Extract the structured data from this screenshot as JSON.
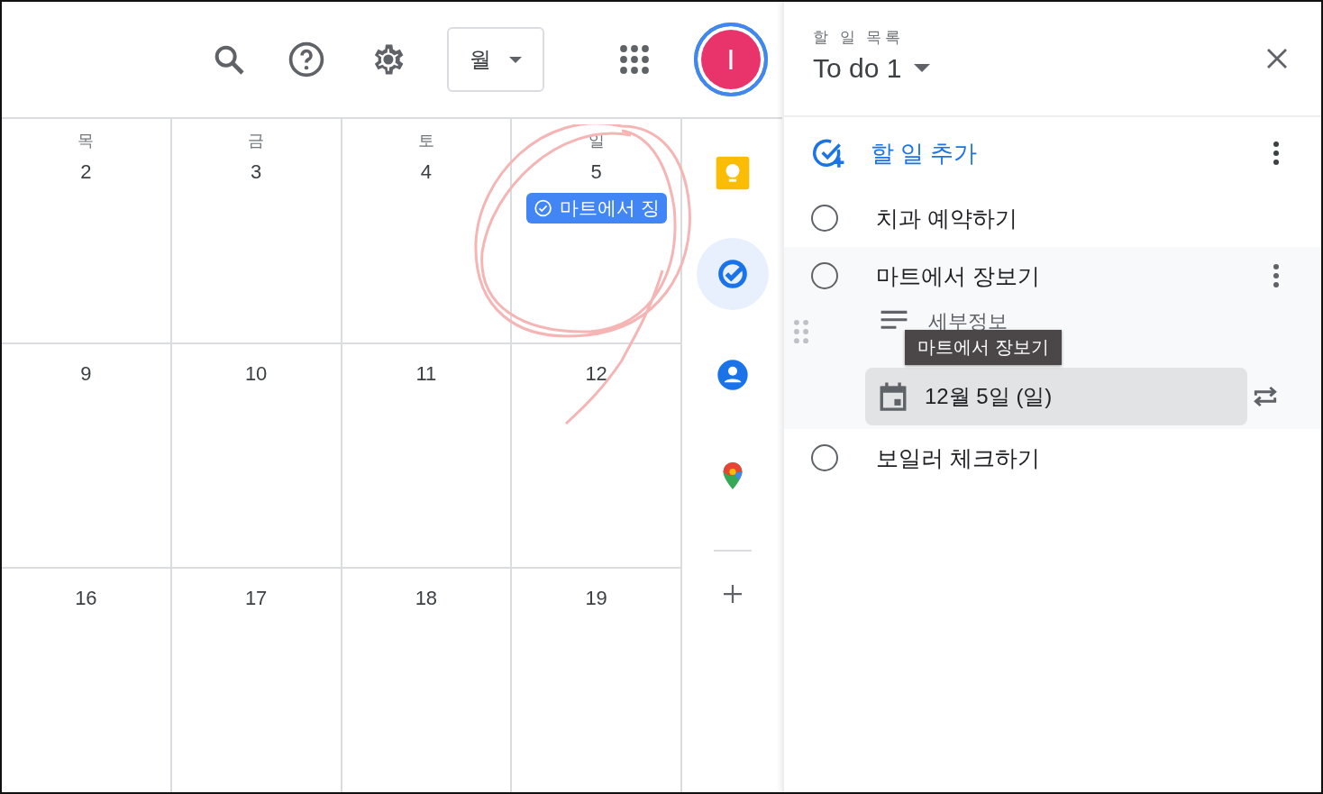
{
  "toolbar": {
    "view_select": "월"
  },
  "avatar": {
    "initial": "I"
  },
  "calendar": {
    "weeks": [
      [
        {
          "weekday": "목",
          "date": "2"
        },
        {
          "weekday": "금",
          "date": "3"
        },
        {
          "weekday": "토",
          "date": "4"
        },
        {
          "weekday": "일",
          "date": "5",
          "events": [
            "마트에서 징"
          ]
        }
      ],
      [
        {
          "date": "9"
        },
        {
          "date": "10"
        },
        {
          "date": "11"
        },
        {
          "date": "12"
        }
      ],
      [
        {
          "date": "16"
        },
        {
          "date": "17"
        },
        {
          "date": "18"
        },
        {
          "date": "19"
        }
      ]
    ]
  },
  "side_panel": {
    "items": [
      {
        "kind": "keep",
        "selected": false
      },
      {
        "kind": "tasks",
        "selected": true
      },
      {
        "kind": "contacts",
        "selected": false
      },
      {
        "kind": "maps",
        "selected": false
      }
    ]
  },
  "tasks_panel": {
    "label": "할 일 목록",
    "list_title": "To do 1",
    "add_task": "할 일 추가",
    "tasks": [
      {
        "title": "치과 예약하기",
        "checked": false,
        "selected": false
      },
      {
        "title": "마트에서 장보기",
        "checked": false,
        "selected": true,
        "details": "세부정보",
        "date": "12월 5일 (일)",
        "tooltip": "마트에서 장보기"
      },
      {
        "title": "보일러 체크하기",
        "checked": false,
        "selected": false
      }
    ]
  }
}
